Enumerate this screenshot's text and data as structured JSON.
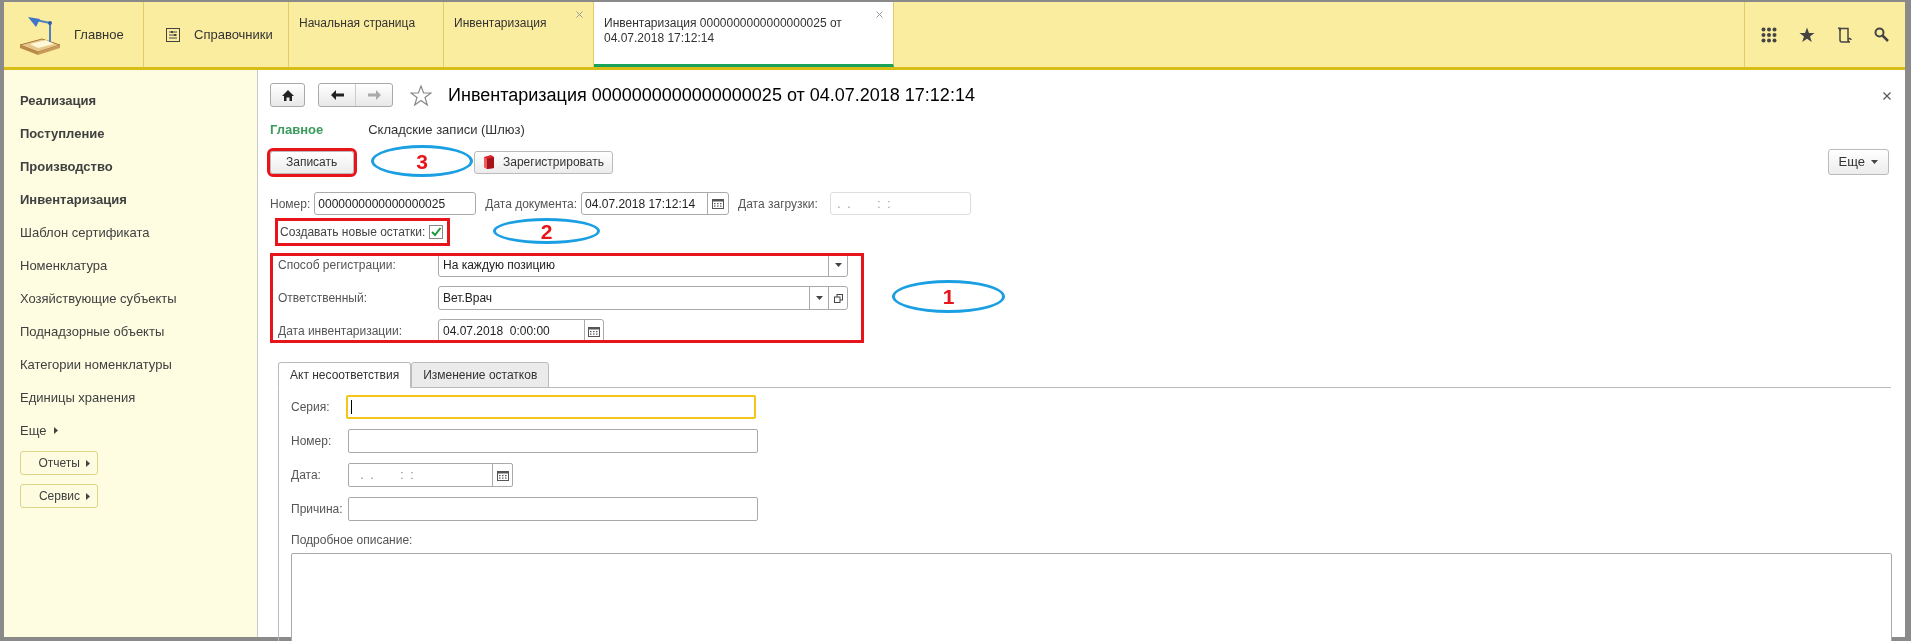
{
  "top_bar": {
    "sections": [
      {
        "label": "Главное",
        "kind": "logo"
      },
      {
        "label": "Справочники",
        "kind": "catalog"
      }
    ],
    "tabs": [
      {
        "label": "Начальная страница",
        "selected": false,
        "closable": false
      },
      {
        "label": "Инвентаризация",
        "selected": false,
        "closable": true
      },
      {
        "label": "Инвентаризация 0000000000000000025 от 04.07.2018 17:12:14",
        "selected": true,
        "closable": true
      }
    ]
  },
  "sidebar": {
    "items": [
      {
        "label": "Реализация",
        "bold": true
      },
      {
        "label": "Поступление",
        "bold": true
      },
      {
        "label": "Производство",
        "bold": true
      },
      {
        "label": "Инвентаризация",
        "bold": true
      },
      {
        "label": "Шаблон сертификата",
        "bold": false
      },
      {
        "label": "Номенклатура",
        "bold": false
      },
      {
        "label": "Хозяйствующие субъекты",
        "bold": false
      },
      {
        "label": "Поднадзорные объекты",
        "bold": false
      },
      {
        "label": "Категории номенклатуры",
        "bold": false
      },
      {
        "label": "Единицы хранения",
        "bold": false
      }
    ],
    "more": "Еще",
    "buttons": [
      "Отчеты",
      "Сервис"
    ]
  },
  "form": {
    "title": "Инвентаризация 0000000000000000025 от 04.07.2018 17:12:14",
    "sections": [
      {
        "label": "Главное",
        "selected": true
      },
      {
        "label": "Складские записи (Шлюз)",
        "selected": false
      }
    ],
    "toolbar": {
      "buttons": [
        {
          "label": "Записать",
          "kind": "plain",
          "highlighted": true
        },
        {
          "label": "Зарегистрировать",
          "kind": "register",
          "highlighted": false
        }
      ],
      "callout": "3",
      "more": "Еще"
    },
    "header_fields": [
      {
        "label": "Номер:",
        "value": "0000000000000000025",
        "kind": "text"
      },
      {
        "label": "Дата документа:",
        "value": "04.07.2018 17:12:14",
        "kind": "date"
      },
      {
        "label": "Дата загрузки:",
        "placeholder": " .  .        :  :",
        "kind": "masked"
      }
    ],
    "checkbox": {
      "label": "Создавать новые остатки:",
      "checked": true,
      "highlighted": true,
      "callout": "2"
    },
    "group": {
      "highlighted": true,
      "callout": "1",
      "fields": [
        {
          "label": "Способ регистрации:",
          "value": "На каждую позицию",
          "kind": "dropdown"
        },
        {
          "label": "Ответственный:",
          "value": "Вет.Врач",
          "kind": "dropdown_open"
        },
        {
          "label": "Дата инвентаризации:",
          "value": "04.07.2018  0:00:00",
          "kind": "date"
        }
      ]
    },
    "tabs": [
      {
        "label": "Акт несоответствия",
        "selected": true
      },
      {
        "label": "Изменение остатков",
        "selected": false
      }
    ],
    "tab_fields": [
      {
        "label": "Серия:",
        "kind": "text",
        "focused": true
      },
      {
        "label": "Номер:",
        "kind": "text",
        "focused": false
      },
      {
        "label": "Дата:",
        "kind": "date",
        "placeholder": " .  .        :  :",
        "focused": false
      },
      {
        "label": "Причина:",
        "kind": "text",
        "focused": false
      }
    ],
    "description": {
      "label": "Подробное описание:"
    }
  }
}
